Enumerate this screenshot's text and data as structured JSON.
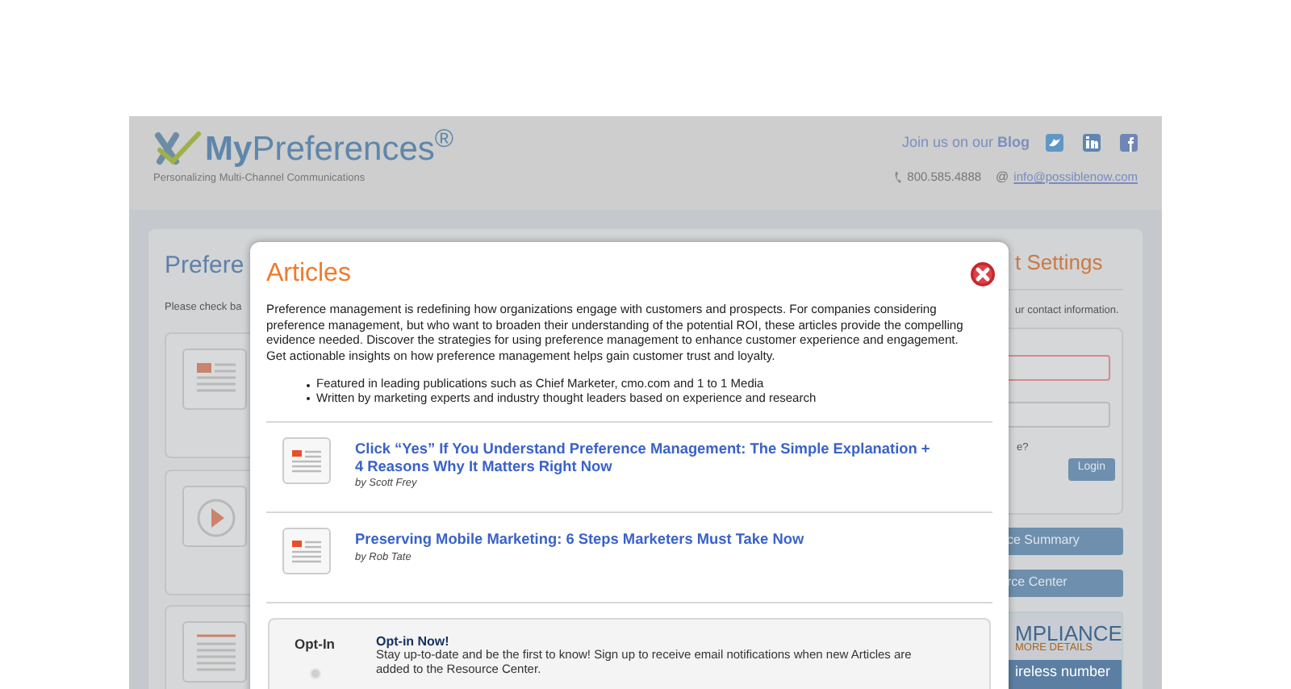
{
  "header": {
    "logo": "**My**Preferences$^{®}$",
    "tagline": "Personalizing Multi-Channel Communications",
    "join_text": "Join us on our **Blog**",
    "phone": "800.585.4888",
    "at": "@",
    "email": "info@possiblenow.com"
  },
  "background": {
    "left_title": "Prefere",
    "left_hint": "Please check ba",
    "cards": [
      {
        "kind": "article"
      },
      {
        "kind": "video"
      },
      {
        "kind": "document"
      }
    ],
    "right_title": "t Settings",
    "right_hint": "ur contact information.",
    "fields": [
      {
        "invalid": true
      },
      {
        "invalid": false
      }
    ],
    "login_hint": "e?",
    "login_button": "Login",
    "buttons": [
      "ce Summary",
      "rce Center"
    ],
    "banner": {
      "title": "MPLIANCE",
      "subtitle": "MORE DETAILS",
      "strip": "ireless number"
    }
  },
  "modal": {
    "title": "Articles",
    "intro": "Preference management is redefining how organizations engage with customers and prospects. For companies considering preference management, but who want to broaden their understanding of the potential ROI, these articles provide the compelling evidence needed. Discover the strategies for using preference management to enhance customer experience and engagement. Get actionable insights on how preference management helps gain customer trust and loyalty.",
    "bullets": [
      "Featured in leading publications such as Chief Marketer, cmo.com and 1 to 1 Media",
      "Written by marketing experts and industry thought leaders based on experience and research"
    ],
    "articles": [
      {
        "title": "Click “Yes” If You Understand Preference Management: The Simple Explanation + 4 Reasons Why It Matters Right Now",
        "author": "by Scott Frey"
      },
      {
        "title": "Preserving Mobile Marketing: 6 Steps Marketers Must Take Now",
        "author": "by Rob Tate"
      }
    ],
    "optin": {
      "label": "Opt-In",
      "checked": false,
      "heading": "Opt-in Now!",
      "text": "Stay up-to-date and be the first to know! Sign up to receive email notifications when new Articles are added to the Resource Center."
    }
  }
}
